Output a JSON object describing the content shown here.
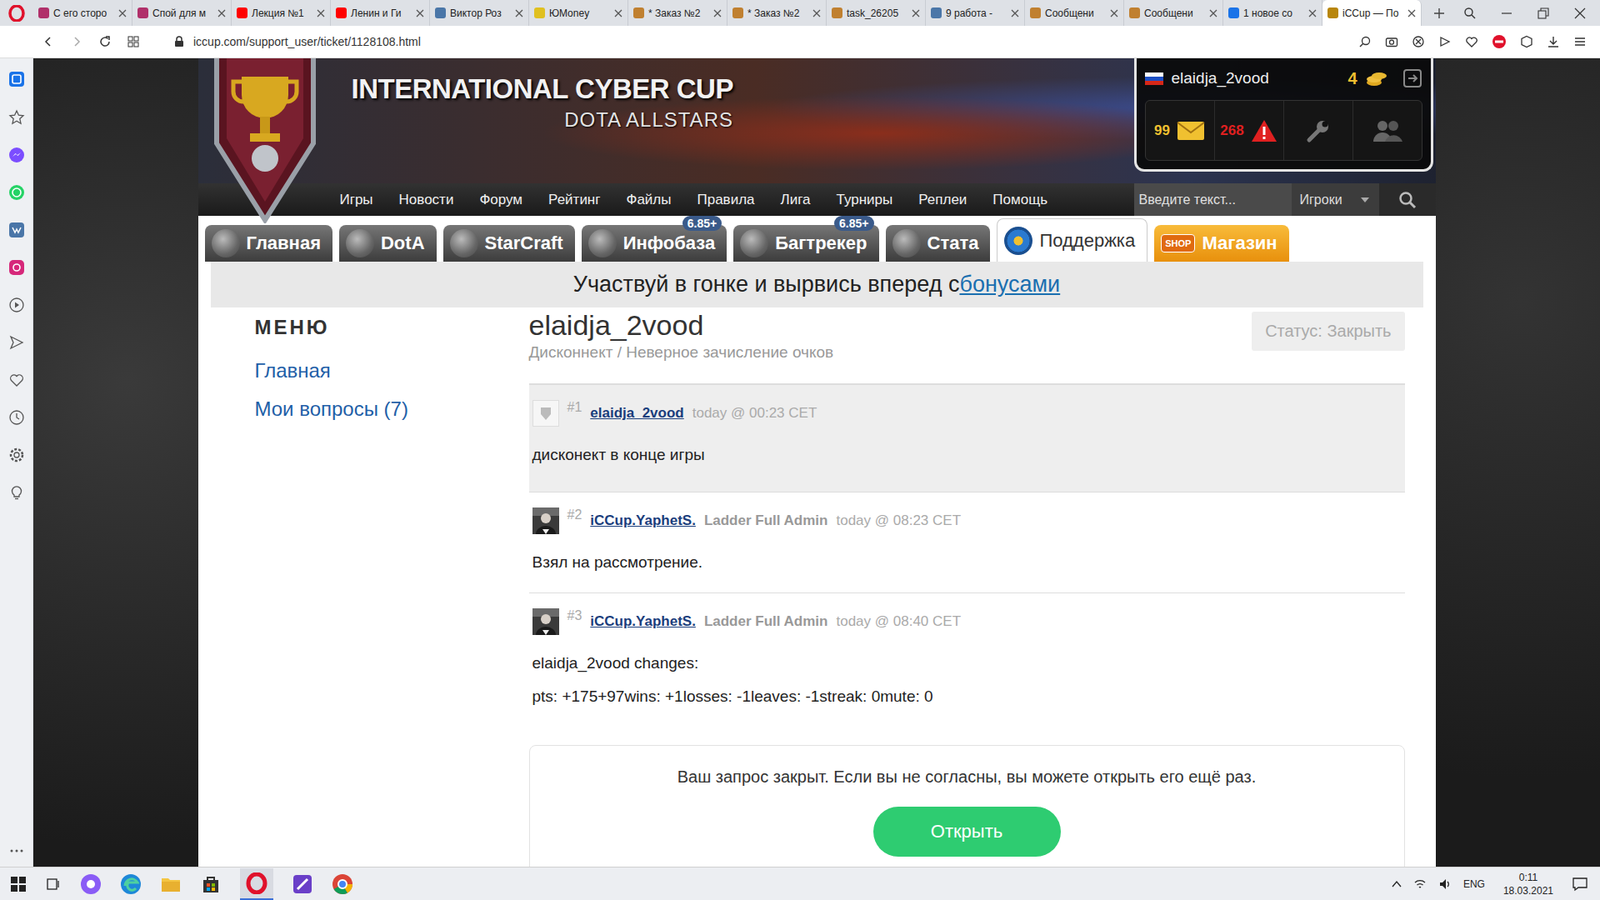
{
  "browser": {
    "tabs": [
      {
        "label": "С его сторо",
        "selected": false,
        "color": "#b0306a"
      },
      {
        "label": "Спой для м",
        "selected": false,
        "color": "#b0306a"
      },
      {
        "label": "Лекция №1",
        "selected": false,
        "color": "#ff0000"
      },
      {
        "label": "Ленин и Ги",
        "selected": false,
        "color": "#ff0000"
      },
      {
        "label": "Виктор Роз",
        "selected": false,
        "color": "#4a76a8"
      },
      {
        "label": "ЮMoney",
        "selected": false,
        "color": "#e0c020"
      },
      {
        "label": "* Заказ №2",
        "selected": false,
        "color": "#c08030"
      },
      {
        "label": "* Заказ №2",
        "selected": false,
        "color": "#c08030"
      },
      {
        "label": "task_26205",
        "selected": false,
        "color": "#c08030"
      },
      {
        "label": "9 работа -",
        "selected": false,
        "color": "#4a76a8"
      },
      {
        "label": "Сообщени",
        "selected": false,
        "color": "#c08030"
      },
      {
        "label": "Сообщени",
        "selected": false,
        "color": "#c08030"
      },
      {
        "label": "1 новое со",
        "selected": false,
        "color": "#1a73e8"
      },
      {
        "label": "iCCup — По",
        "selected": true,
        "color": "#b8860b"
      }
    ],
    "url": "iccup.com/support_user/ticket/1128108.html"
  },
  "site": {
    "title": "INTERNATIONAL CYBER CUP",
    "subtitle": "DOTA ALLSTARS"
  },
  "user_panel": {
    "username": "elaidja_2vood",
    "coins": "4",
    "messages": "99",
    "warnings": "268"
  },
  "nav": [
    "Игры",
    "Новости",
    "Форум",
    "Рейтинг",
    "Файлы",
    "Правила",
    "Лига",
    "Турниры",
    "Реплеи",
    "Помощь"
  ],
  "search": {
    "placeholder": "Введите текст...",
    "scope": "Игроки"
  },
  "tabs": [
    {
      "label": "Главная",
      "selected": false,
      "kind": "normal"
    },
    {
      "label": "DotA",
      "selected": false,
      "kind": "normal"
    },
    {
      "label": "StarCraft",
      "selected": false,
      "kind": "normal"
    },
    {
      "label": "Инфобаза",
      "selected": false,
      "kind": "normal",
      "badge": "6.85+"
    },
    {
      "label": "Багтрекер",
      "selected": false,
      "kind": "normal",
      "badge": "6.85+"
    },
    {
      "label": "Стата",
      "selected": false,
      "kind": "normal"
    },
    {
      "label": "Поддержка",
      "selected": true,
      "kind": "normal"
    },
    {
      "label": "Магазин",
      "selected": false,
      "kind": "shop",
      "icon_text": "SHOP"
    }
  ],
  "promo": {
    "text": "Участвуй в гонке и вырвись вперед с ",
    "link": "бонусами"
  },
  "menu": {
    "title": "МЕНЮ",
    "items": [
      "Главная",
      "Мои вопросы (7)"
    ]
  },
  "ticket": {
    "title": "elaidja_2vood",
    "category": "Дисконнект / Неверное зачисление очков",
    "status": "Статус: Закрыть"
  },
  "posts": [
    {
      "number": "#1",
      "author": "elaidja_2vood",
      "role": "",
      "time": "today @ 00:23 CET",
      "lines": [
        "дисконект в конце игры"
      ],
      "highlighted": true,
      "kind": "placeholder"
    },
    {
      "number": "#2",
      "author": "iCCup.YaphetS.",
      "role": "Ladder Full Admin",
      "time": "today @ 08:23 CET",
      "lines": [
        "Взял на рассмотрение."
      ],
      "highlighted": false,
      "kind": "photo"
    },
    {
      "number": "#3",
      "author": "iCCup.YaphetS.",
      "role": "Ladder Full Admin",
      "time": "today @ 08:40 CET",
      "lines": [
        "elaidja_2vood changes:",
        "pts: +175+97wins: +1losses: -1leaves: -1streak: 0mute: 0"
      ],
      "highlighted": false,
      "kind": "photo"
    }
  ],
  "closed": {
    "message": "Ваш запрос закрыт. Если вы не согласны, вы можете открыть его ещё раз.",
    "button": "Открыть"
  },
  "taskbar": {
    "language": "ENG",
    "time": "0:11",
    "date": "18.03.2021"
  }
}
